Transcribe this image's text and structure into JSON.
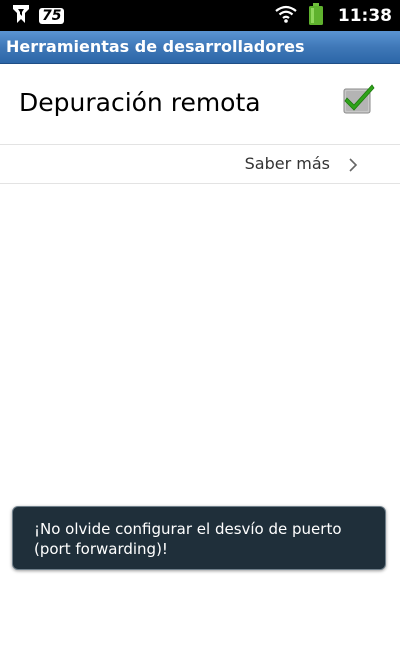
{
  "status_bar": {
    "badge_count": "75",
    "time": "11:38",
    "icons": [
      "app-notification-icon",
      "wifi-icon",
      "battery-icon"
    ]
  },
  "title_bar": {
    "title": "Herramientas de desarrolladores"
  },
  "settings": {
    "remote_debugging_label": "Depuración remota",
    "remote_debugging_checked": true,
    "learn_more_label": "Saber más"
  },
  "toast": {
    "message": "¡No olvide configurar el desvío de puerto (port forwarding)!"
  },
  "colors": {
    "title_bar": "#3f78b8",
    "toast_background": "#1f2f3a",
    "checkmark": "#2fa31a"
  }
}
